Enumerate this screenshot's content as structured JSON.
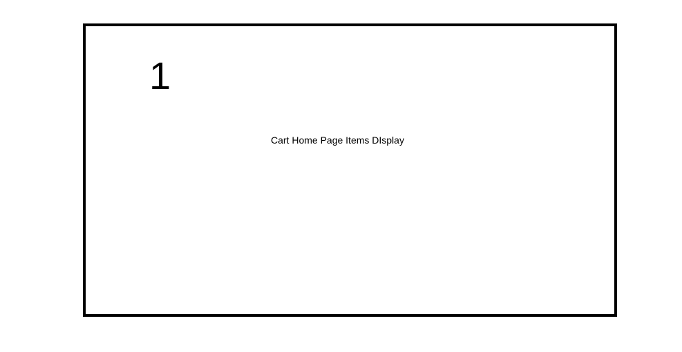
{
  "frame": {
    "number": "1",
    "caption": "Cart Home Page   Items DIsplay",
    "border_color": "#000000",
    "background_color": "#ffffff"
  }
}
